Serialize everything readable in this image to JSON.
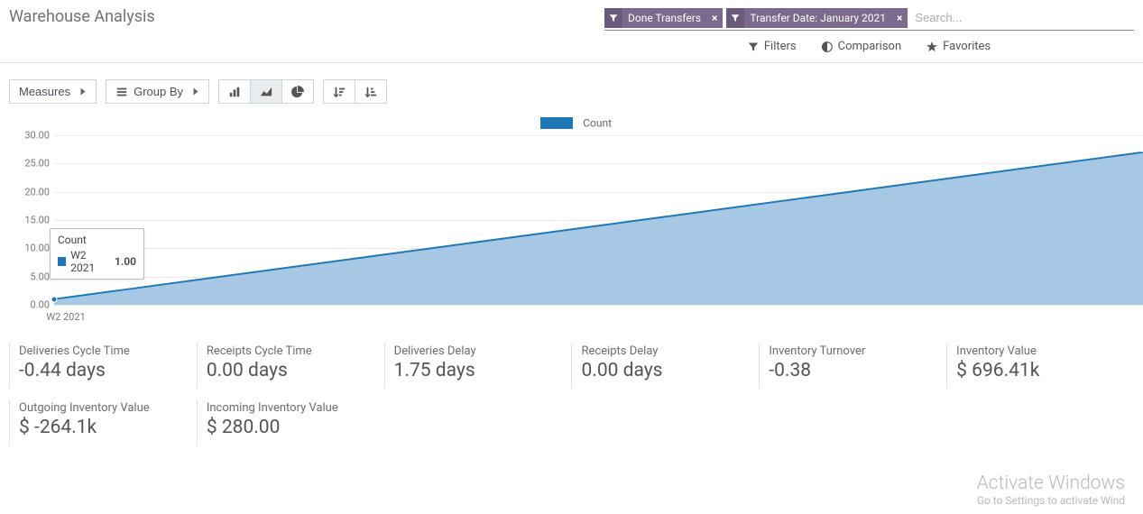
{
  "header": {
    "title": "Warehouse Analysis"
  },
  "search": {
    "facets": [
      {
        "label": "Done Transfers"
      },
      {
        "label": "Transfer Date: January 2021"
      }
    ],
    "placeholder": "Search...",
    "options": {
      "filters": "Filters",
      "comparison": "Comparison",
      "favorites": "Favorites"
    }
  },
  "toolbar": {
    "measures": "Measures",
    "group_by": "Group By"
  },
  "chart_data": {
    "type": "area",
    "title": "",
    "xlabel": "",
    "ylabel": "",
    "ylim": [
      0,
      30
    ],
    "y_ticks": [
      "0.00",
      "5.00",
      "10.00",
      "15.00",
      "20.00",
      "25.00",
      "30.00"
    ],
    "legend": "Count",
    "categories": [
      "W2 2021"
    ],
    "series": [
      {
        "name": "Count",
        "values": [
          1.0
        ]
      }
    ],
    "tooltip": {
      "title": "Count",
      "category": "W2 2021",
      "value": "1.00"
    },
    "visual_range_end_value": 27
  },
  "kpis": [
    {
      "label": "Deliveries Cycle Time",
      "value": "-0.44 days"
    },
    {
      "label": "Receipts Cycle Time",
      "value": "0.00 days"
    },
    {
      "label": "Deliveries Delay",
      "value": "1.75 days"
    },
    {
      "label": "Receipts Delay",
      "value": "0.00 days"
    },
    {
      "label": "Inventory Turnover",
      "value": "-0.38"
    },
    {
      "label": "Inventory Value",
      "value": "$ 696.41k"
    },
    {
      "label": "Outgoing Inventory Value",
      "value": "$ -264.1k"
    },
    {
      "label": "Incoming Inventory Value",
      "value": "$ 280.00"
    }
  ],
  "watermark": {
    "title": "Activate Windows",
    "sub": "Go to Settings to activate Wind"
  }
}
